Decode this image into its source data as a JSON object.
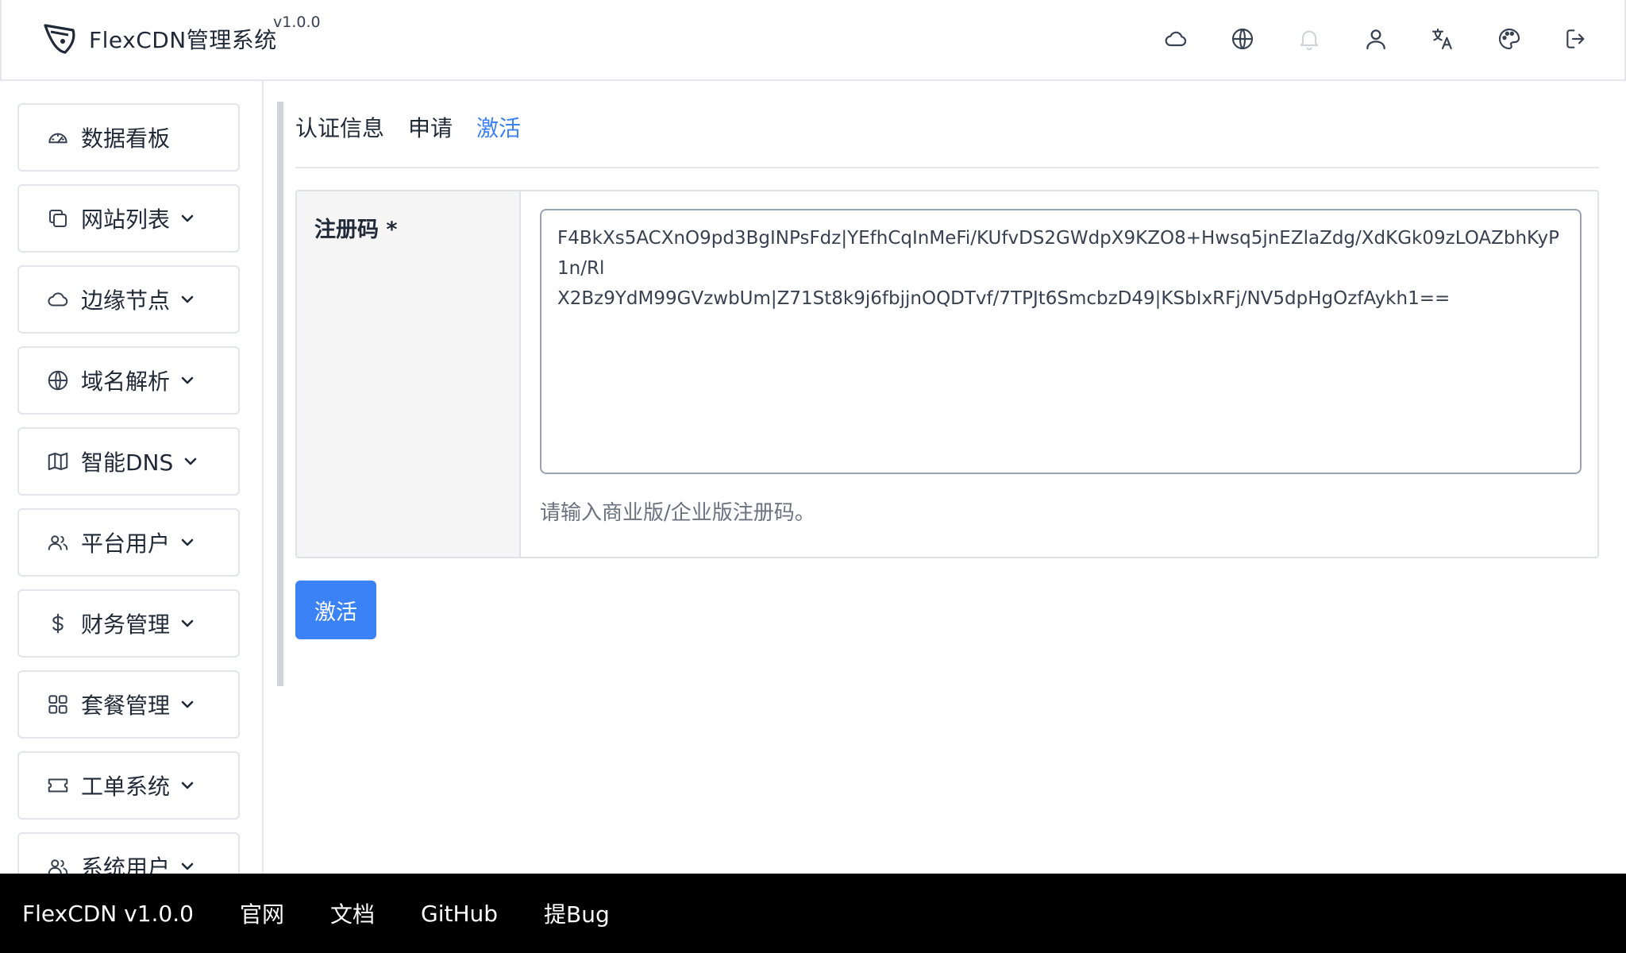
{
  "header": {
    "app_title": "FlexCDN管理系统",
    "version": "v1.0.0",
    "icons": [
      "cloud-icon",
      "globe-icon",
      "bell-icon",
      "user-icon",
      "translate-icon",
      "palette-icon",
      "logout-icon"
    ]
  },
  "sidebar": {
    "items": [
      {
        "label": "数据看板",
        "icon": "dashboard-icon",
        "expandable": false
      },
      {
        "label": "网站列表",
        "icon": "copy-icon",
        "expandable": true
      },
      {
        "label": "边缘节点",
        "icon": "cloud-icon",
        "expandable": true
      },
      {
        "label": "域名解析",
        "icon": "globe-icon",
        "expandable": true
      },
      {
        "label": "智能DNS",
        "icon": "map-icon",
        "expandable": true
      },
      {
        "label": "平台用户",
        "icon": "users-icon",
        "expandable": true
      },
      {
        "label": "财务管理",
        "icon": "dollar-icon",
        "expandable": true
      },
      {
        "label": "套餐管理",
        "icon": "grid-icon",
        "expandable": true
      },
      {
        "label": "工单系统",
        "icon": "ticket-icon",
        "expandable": true
      },
      {
        "label": "系统用户",
        "icon": "users-icon",
        "expandable": true
      }
    ]
  },
  "tabs": [
    {
      "label": "认证信息",
      "active": false
    },
    {
      "label": "申请",
      "active": false
    },
    {
      "label": "激活",
      "active": true
    }
  ],
  "form": {
    "field_label": "注册码 *",
    "code_value": "F4BkXs5ACXnO9pd3BgINPsFdz|YEfhCqInMeFi/KUfvDS2GWdpX9KZO8+Hwsq5jnEZlaZdg/XdKGk09zLOAZbhKyP1n/Rl\nX2Bz9YdM99GVzwbUm|Z71St8k9j6fbjjnOQDTvf/7TPJt6SmcbzD49|KSbIxRFj/NV5dpHgOzfAykh1==",
    "hint": "请输入商业版/企业版注册码。"
  },
  "submit_label": "激活",
  "footer": {
    "items": [
      "FlexCDN v1.0.0",
      "官网",
      "文档",
      "GitHub",
      "提Bug"
    ]
  },
  "colors": {
    "accent": "#3b82f6",
    "footer_bg": "#000000",
    "label_bg": "#f5f5f5"
  }
}
